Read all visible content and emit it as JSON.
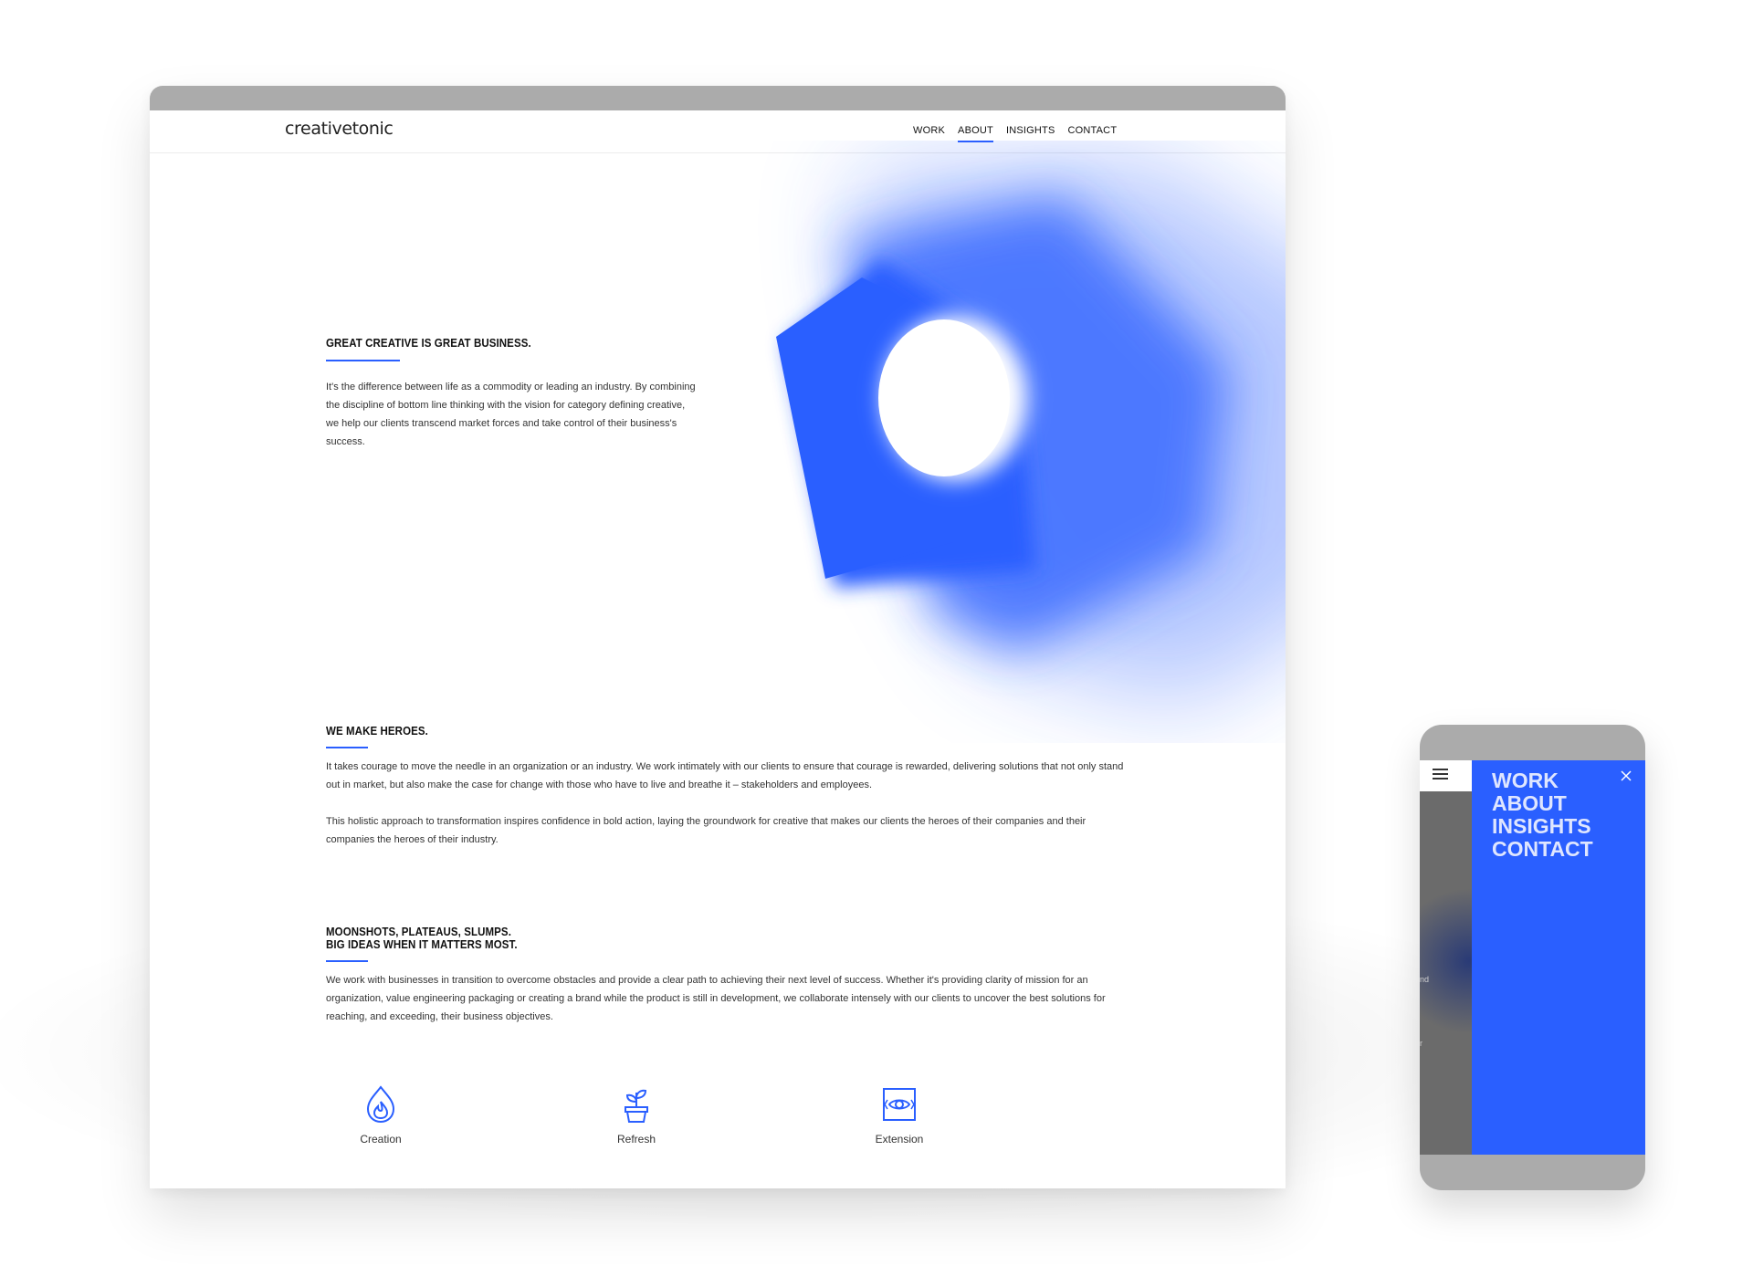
{
  "site": {
    "logo": "creativetonic",
    "nav": [
      {
        "label": "WORK",
        "active": false
      },
      {
        "label": "ABOUT",
        "active": true
      },
      {
        "label": "INSIGHTS",
        "active": false
      },
      {
        "label": "CONTACT",
        "active": false
      }
    ]
  },
  "colors": {
    "accent": "#2a5fff",
    "browser_chrome": "#ababab"
  },
  "sections": [
    {
      "title_lines": [
        "GREAT CREATIVE IS GREAT BUSINESS."
      ],
      "paragraphs": [
        "It's the difference between life as a commodity or leading an industry. By combining the discipline of bottom line thinking with the vision for category defining creative, we help our clients transcend market forces and take control of their business's success."
      ]
    },
    {
      "title_lines": [
        "WE MAKE HEROES."
      ],
      "paragraphs": [
        "It takes courage to move the needle in an organization or an industry. We work intimately with our clients to ensure that courage is rewarded, delivering solutions that not only stand out in market, but also make the case for change with those who have to live and breathe it – stakeholders and employees.",
        "This holistic approach to transformation inspires confidence in bold action, laying the groundwork for creative that makes our clients the heroes of their companies and their companies the heroes of their industry."
      ]
    },
    {
      "title_lines": [
        "MOONSHOTS, PLATEAUS, SLUMPS.",
        "BIG IDEAS WHEN IT MATTERS MOST."
      ],
      "paragraphs": [
        "We work with businesses in transition to overcome obstacles and provide a clear path to achieving their next level of success. Whether it's providing clarity of mission for an organization, value engineering packaging or creating a brand while the product is still in development, we collaborate intensely with our clients to uncover the best solutions for reaching, and exceeding, their business objectives."
      ]
    }
  ],
  "features": [
    {
      "label": "Creation",
      "icon": "flame-icon"
    },
    {
      "label": "Refresh",
      "icon": "plant-pot-icon"
    },
    {
      "label": "Extension",
      "icon": "eye-frame-icon"
    }
  ],
  "mobile": {
    "menu": [
      "WORK",
      "ABOUT",
      "INSIGHTS",
      "CONTACT"
    ],
    "ghost_text": [
      "nd",
      "r"
    ]
  }
}
